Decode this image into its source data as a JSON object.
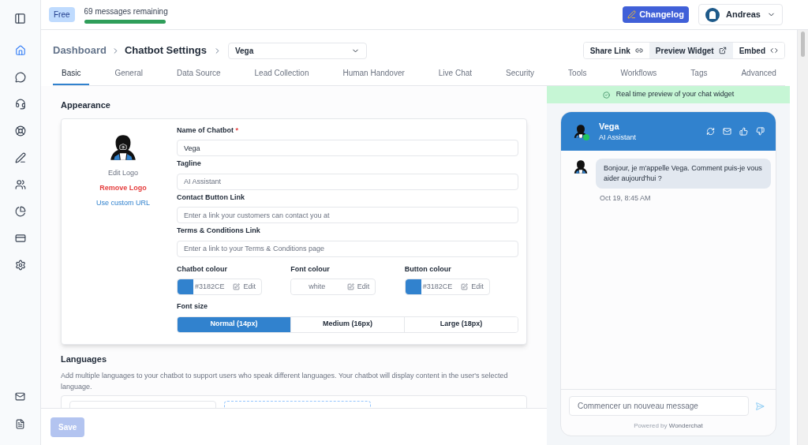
{
  "plan": {
    "badge": "Free",
    "messages": "69 messages remaining",
    "level": 1
  },
  "header_buttons": {
    "changelog": "Changelog",
    "user": "Andreas"
  },
  "sidebar": {
    "items": [
      {
        "kind": "home",
        "selected": true
      },
      {
        "kind": "chat",
        "selected": false
      },
      {
        "kind": "headset",
        "selected": false
      },
      {
        "kind": "lifebuoy",
        "selected": false
      },
      {
        "kind": "pen",
        "selected": false
      },
      {
        "kind": "users",
        "selected": false
      },
      {
        "kind": "chart",
        "selected": false
      },
      {
        "kind": "card",
        "selected": false
      },
      {
        "kind": "settings",
        "selected": false
      }
    ],
    "bottom": [
      {
        "kind": "mail"
      },
      {
        "kind": "file"
      }
    ]
  },
  "breadcrumb": [
    "Dashboard",
    "Chatbot Settings"
  ],
  "bot_select": {
    "value": "Vega"
  },
  "actions": [
    {
      "label": "Share Link",
      "kind": "link",
      "selected": false
    },
    {
      "label": "Preview Widget",
      "kind": "external",
      "selected": true
    },
    {
      "label": "Embed",
      "kind": "code",
      "selected": false
    }
  ],
  "tabs": [
    {
      "label": "Basic",
      "selected": true
    },
    {
      "label": "General",
      "selected": false
    },
    {
      "label": "Data Source",
      "selected": false
    },
    {
      "label": "Lead Collection",
      "selected": false
    },
    {
      "label": "Human Handover",
      "selected": false
    },
    {
      "label": "Live Chat",
      "selected": false
    },
    {
      "label": "Security",
      "selected": false
    },
    {
      "label": "Tools",
      "selected": false
    },
    {
      "label": "Workflows",
      "selected": false
    },
    {
      "label": "Tags",
      "selected": false
    },
    {
      "label": "Advanced",
      "selected": false
    }
  ],
  "appearance": {
    "title": "Appearance",
    "logo": {
      "edit": "Edit Logo",
      "remove": "Remove Logo",
      "custom": "Use custom URL"
    },
    "required_mark": "*",
    "fields": [
      {
        "label": "Name of Chatbot",
        "required": true,
        "value": "Vega"
      },
      {
        "label": "Tagline",
        "required": false,
        "placeholder": "AI Assistant"
      },
      {
        "label": "Contact Button Link",
        "required": false,
        "placeholder": "Enter a link your customers can contact you at"
      },
      {
        "label": "Terms & Conditions Link",
        "required": false,
        "placeholder": "Enter a link to your Terms & Conditions page"
      }
    ],
    "colours": [
      {
        "label": "Chatbot colour",
        "value": "#3182CE",
        "color": "#3182ce",
        "edit": "Edit"
      },
      {
        "label": "Font colour",
        "value": "white",
        "color": "#ffffff",
        "edit": "Edit"
      },
      {
        "label": "Button colour",
        "value": "#3182CE",
        "color": "#3182ce",
        "edit": "Edit"
      }
    ],
    "font_size": {
      "label": "Font size",
      "options": [
        {
          "label": "Normal (14px)",
          "selected": true
        },
        {
          "label": "Medium (16px)",
          "selected": false
        },
        {
          "label": "Large (18px)",
          "selected": false
        }
      ]
    }
  },
  "languages": {
    "title": "Languages",
    "description": "Add multiple languages to your chatbot to support users who speak different languages. Your chatbot will display content in the user's selected language."
  },
  "save": {
    "label": "Save",
    "disabled": true
  },
  "preview": {
    "banner": "Real time preview of your chat widget",
    "name": "Vega",
    "tagline": "AI Assistant",
    "online": true,
    "messages": [
      {
        "text": "Bonjour, je m'appelle Vega. Comment puis-je vous aider aujourd'hui ?",
        "time": "Oct 19, 8:45 AM"
      }
    ],
    "input_placeholder": "Commencer un nouveau message",
    "powered": "Powered by",
    "brand": "Wonderchat"
  }
}
